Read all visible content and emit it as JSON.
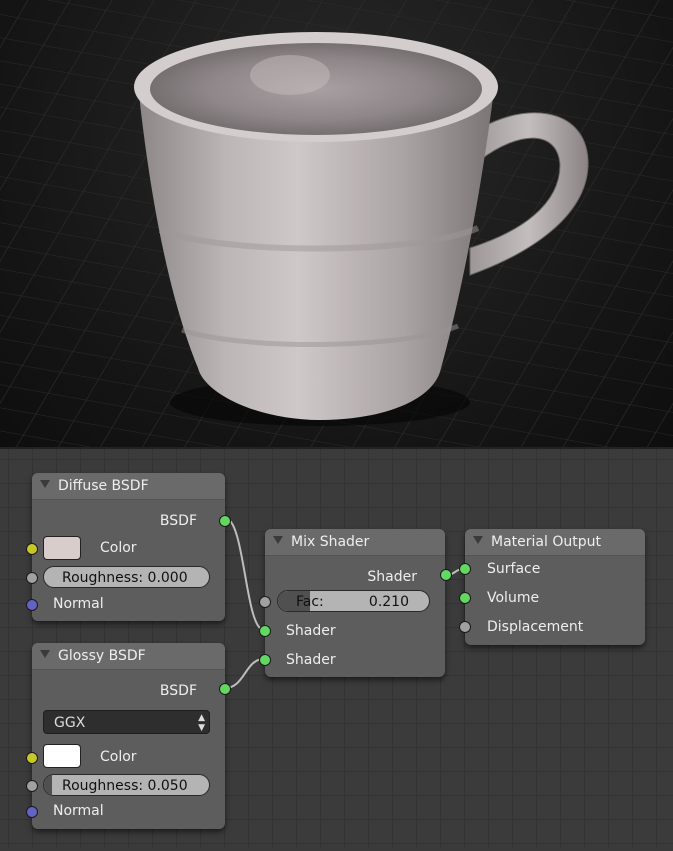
{
  "colors": {
    "socket_shader": "#62d862",
    "socket_color": "#c7c729",
    "socket_float": "#a1a1a1",
    "socket_vector": "#6363c7",
    "diffuse_color": "#d8cdcb",
    "glossy_color": "#ffffff"
  },
  "render": {
    "subject": "cup"
  },
  "nodes": {
    "diffuse": {
      "title": "Diffuse BSDF",
      "output": "BSDF",
      "color_label": "Color",
      "roughness_label": "Roughness: 0.000",
      "roughness_value": 0.0,
      "normal_label": "Normal"
    },
    "glossy": {
      "title": "Glossy BSDF",
      "output": "BSDF",
      "distribution": "GGX",
      "color_label": "Color",
      "roughness_label": "Roughness: 0.050",
      "roughness_value": 0.05,
      "normal_label": "Normal"
    },
    "mix": {
      "title": "Mix Shader",
      "output": "Shader",
      "fac_label": "Fac:",
      "fac_value": "0.210",
      "fac_fraction": 0.21,
      "shader1_label": "Shader",
      "shader2_label": "Shader"
    },
    "output": {
      "title": "Material Output",
      "surface_label": "Surface",
      "volume_label": "Volume",
      "displacement_label": "Displacement"
    }
  }
}
